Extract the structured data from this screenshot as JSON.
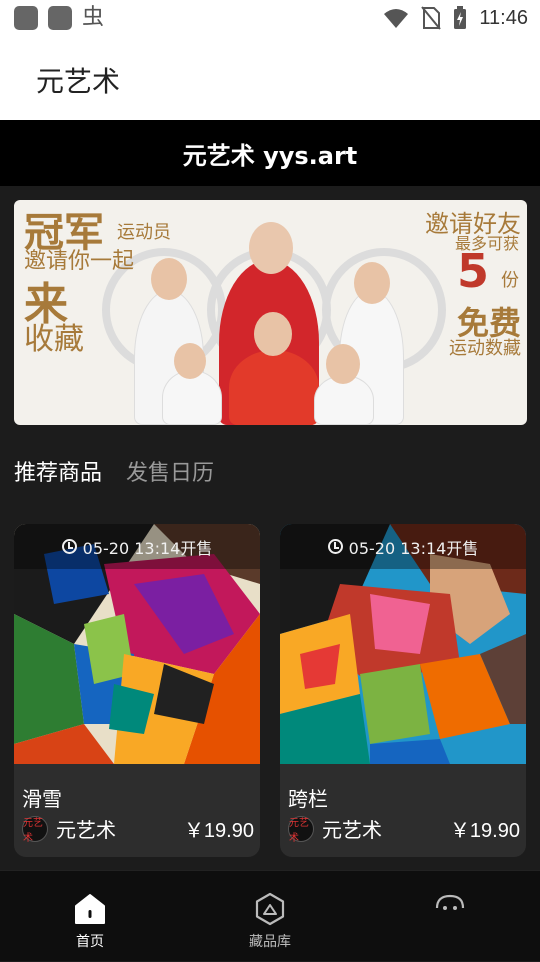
{
  "status_bar": {
    "time": "11:46",
    "icons": [
      "app-square-icon",
      "app-square-icon",
      "bug-icon",
      "wifi-icon",
      "no-sim-icon",
      "battery-charging-icon"
    ]
  },
  "app_bar": {
    "title": "元艺术"
  },
  "header": {
    "title": "元艺术 yys.art"
  },
  "banner": {
    "left_big": "冠军",
    "left_small": "运动员",
    "left_line2": "邀请你一起",
    "left_lai": "来",
    "left_shoucang": "收藏",
    "right_line1": "邀请好友",
    "right_line2": "最多可获",
    "right_number": "5",
    "right_unit": "份",
    "right_line4": "免费",
    "right_line5": "运动数藏"
  },
  "tabs": [
    {
      "label": "推荐商品",
      "active": true
    },
    {
      "label": "发售日历",
      "active": false
    }
  ],
  "products": [
    {
      "sale_time": "05-20 13:14开售",
      "name": "滑雪",
      "brand": "元艺术",
      "brand_logo_text": "元艺术",
      "price": "￥19.90"
    },
    {
      "sale_time": "05-20 13:14开售",
      "name": "跨栏",
      "brand": "元艺术",
      "brand_logo_text": "元艺术",
      "price": "￥19.90"
    }
  ],
  "bottom_nav": [
    {
      "label": "首页",
      "icon": "home-icon",
      "active": true
    },
    {
      "label": "藏品库",
      "icon": "collection-hexagon-icon",
      "active": false
    },
    {
      "label": "",
      "icon": "profile-icon",
      "active": false
    }
  ]
}
